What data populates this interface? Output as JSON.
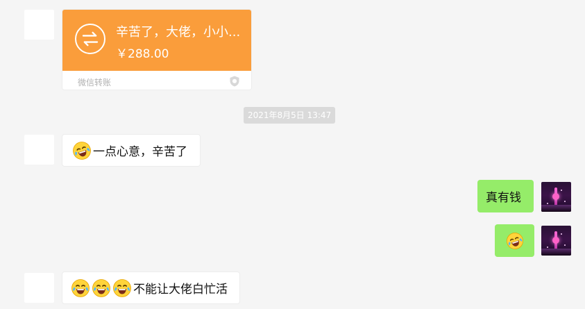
{
  "messages": {
    "transfer": {
      "title": "辛苦了，大佬，小小...",
      "amount": "￥288.00",
      "footer": "微信转账"
    },
    "timestamp": "2021年8月5日 13:47",
    "msg1": {
      "text": "一点心意，辛苦了"
    },
    "msg2": {
      "text": "真有钱"
    },
    "msg4": {
      "text": "不能让大佬白忙活"
    }
  },
  "icons": {
    "transfer": "transfer-arrows-icon",
    "shield": "shield-icon",
    "emoji": "laughing-crying-emoji-icon"
  },
  "colors": {
    "transfer_orange": "#fa9d3b",
    "outgoing_green": "#95ec69",
    "background": "#f5f5f5"
  }
}
